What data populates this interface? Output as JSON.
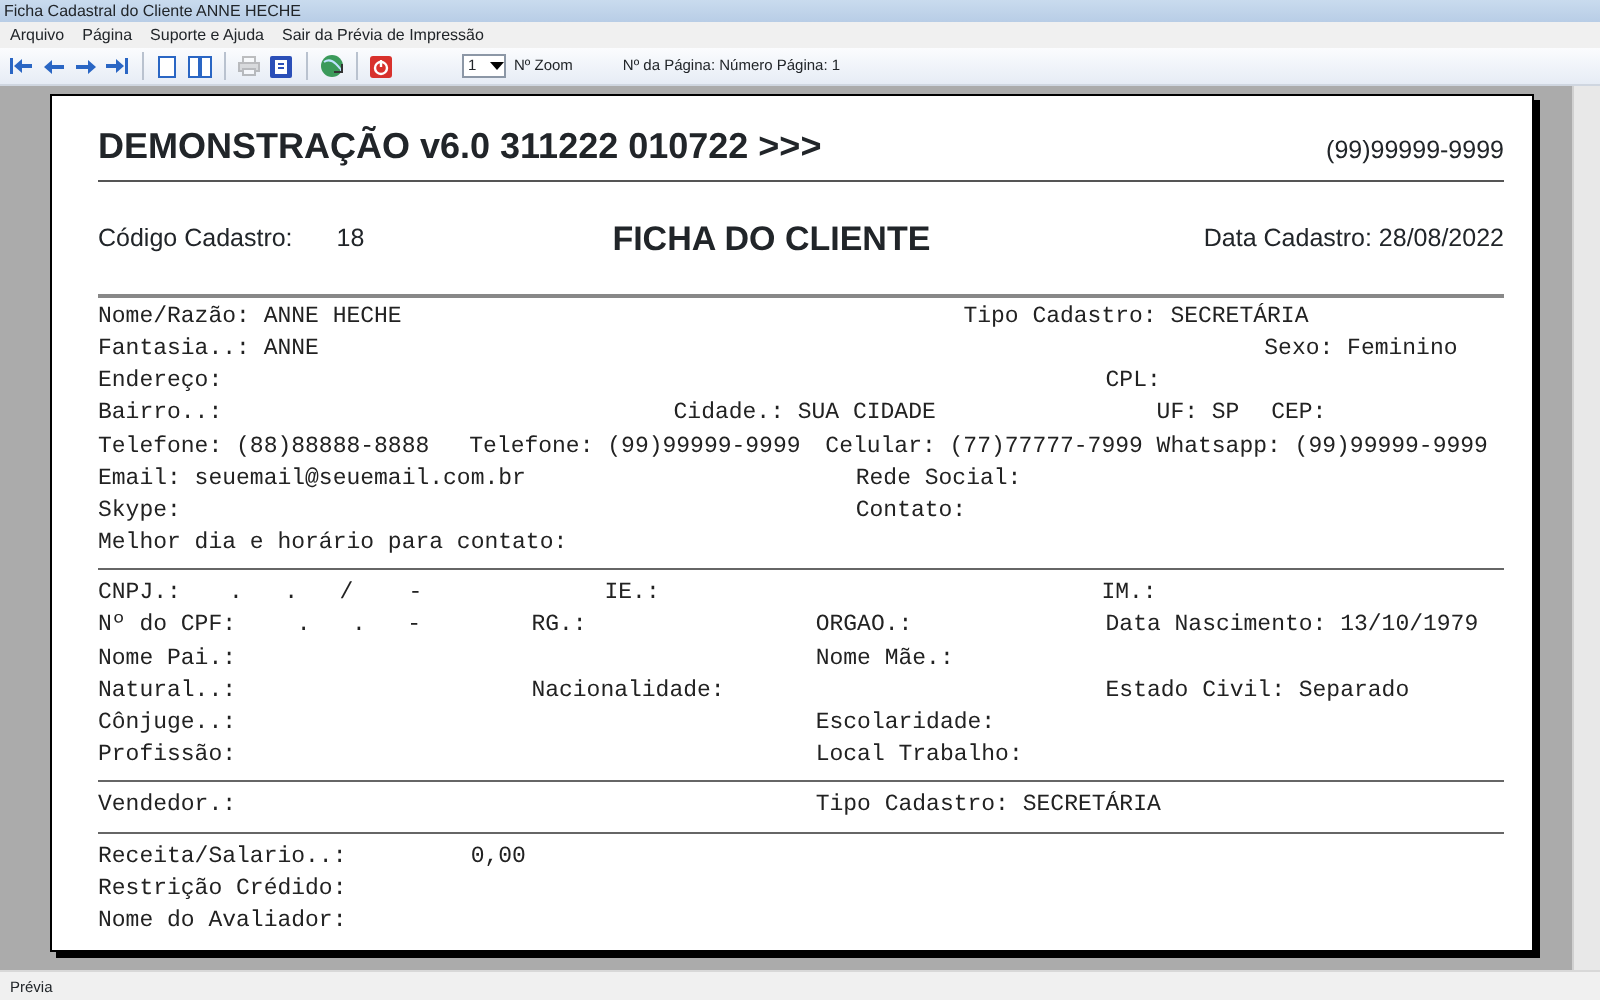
{
  "window": {
    "title": "Ficha Cadastral do Cliente ANNE HECHE"
  },
  "menu": [
    "Arquivo",
    "Página",
    "Suporte e Ajuda",
    "Sair da Prévia de Impressão"
  ],
  "toolbar": [
    {
      "kind": "first",
      "disabled": false
    },
    {
      "kind": "prev",
      "disabled": false
    },
    {
      "kind": "next",
      "disabled": false
    },
    {
      "kind": "last",
      "disabled": false
    },
    {
      "kind": "sep"
    },
    {
      "kind": "page",
      "disabled": false
    },
    {
      "kind": "twopage",
      "disabled": false
    },
    {
      "kind": "sep"
    },
    {
      "kind": "print",
      "disabled": true
    },
    {
      "kind": "export",
      "disabled": false
    },
    {
      "kind": "sep"
    },
    {
      "kind": "globe",
      "disabled": false
    },
    {
      "kind": "sep"
    },
    {
      "kind": "close",
      "disabled": false
    }
  ],
  "zoom": {
    "value": "1",
    "label": "Nº Zoom"
  },
  "page_info": "Nº da Página: Número Página: 1",
  "report": {
    "title": "DEMONSTRAÇÃO v6.0 311222 010722 >>>",
    "phone": "(99)99999-9999",
    "code_label": "Código Cadastro:",
    "code_value": "18",
    "heading": "FICHA DO CLIENTE",
    "date": "Data Cadastro: 28/08/2022",
    "sections": [
      [
        [
          "Nome/Razão: ANNE HECHE",
          "Tipo Cadastro: SECRETÁRIA"
        ],
        [
          "Fantasia..: ANNE",
          "Sexo: Feminino"
        ],
        [
          "Endereço:",
          "CPL:"
        ],
        [
          "Bairro..:",
          "Cidade.: SUA CIDADE",
          "UF: SP",
          "CEP:"
        ],
        [
          "Telefone: (88)88888-8888",
          "Telefone: (99)99999-9999",
          "Celular: (77)77777-7999",
          "Whatsapp: (99)99999-9999"
        ],
        [
          "Email: seuemail@seuemail.com.br",
          "Rede Social:"
        ],
        [
          "Skype:",
          "Contato:"
        ],
        [
          "Melhor dia e horário para contato:"
        ]
      ],
      [
        [
          "CNPJ.:",
          ".   .   /    -",
          "IE.:",
          "IM.:"
        ],
        [
          "Nº do CPF:",
          ".   .   -",
          "RG.:",
          "ORGAO.:",
          "Data Nascimento: 13/10/1979"
        ],
        [
          "Nome Pai.:",
          "Nome Mãe.:"
        ],
        [
          "Natural..:",
          "Nacionalidade:",
          "Estado Civil: Separado"
        ],
        [
          "Cônjuge..:",
          "Escolaridade:"
        ],
        [
          "Profissão:",
          "Local Trabalho:"
        ]
      ],
      [
        [
          "Vendedor.:",
          "Tipo Cadastro: SECRETÁRIA"
        ]
      ],
      [
        [
          "Receita/Salario..:",
          "0,00"
        ],
        [
          "Restrição Crédido:"
        ],
        [
          "Nome do Avaliador:"
        ]
      ]
    ]
  },
  "status_bar": "Prévia"
}
